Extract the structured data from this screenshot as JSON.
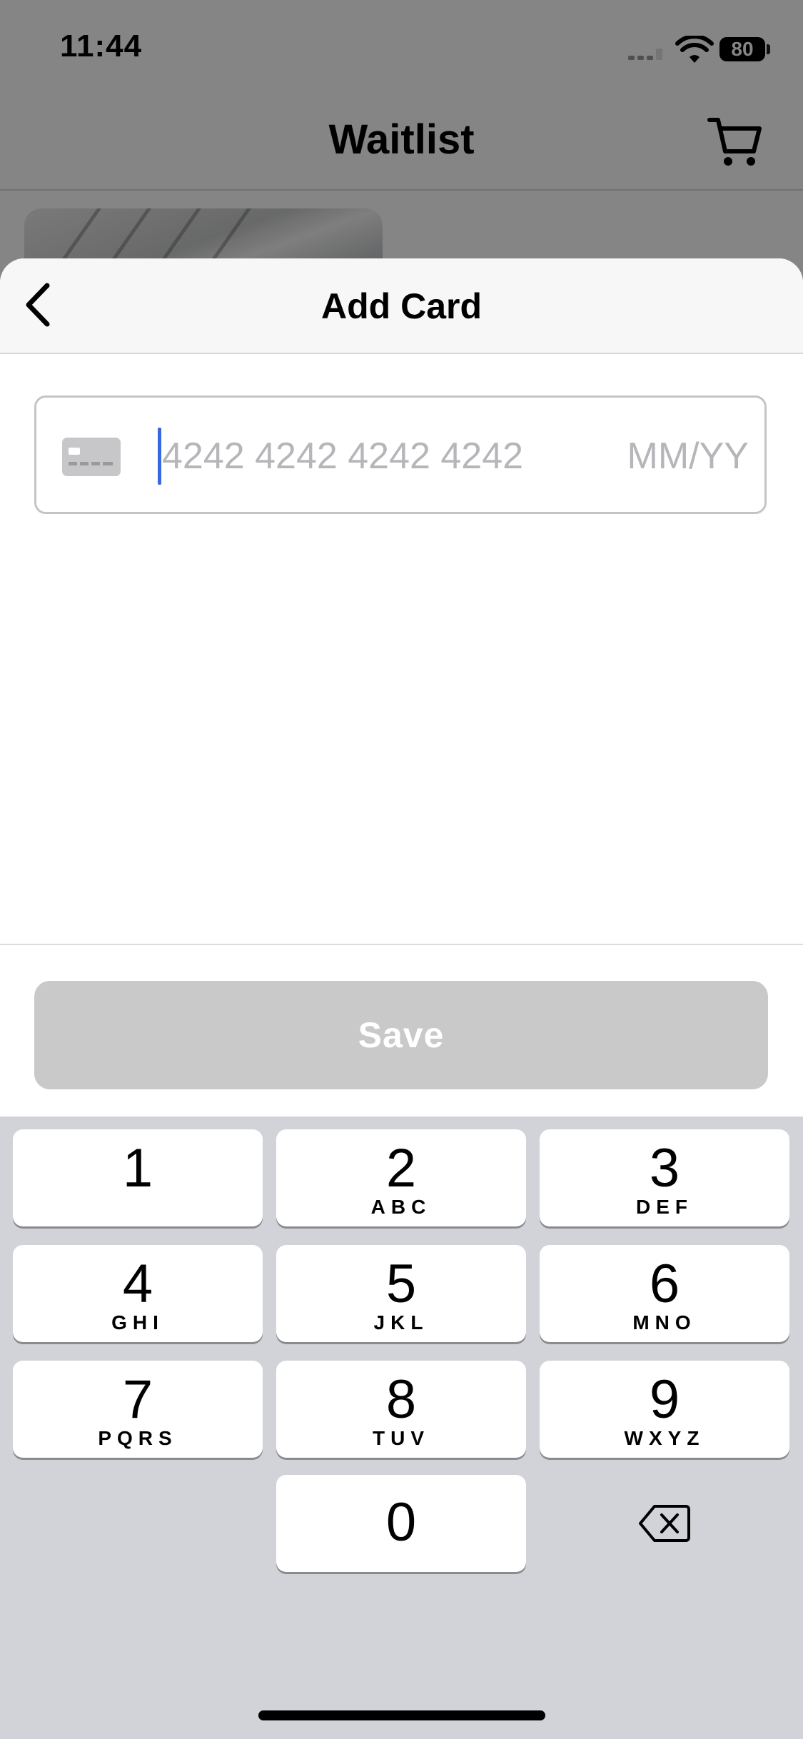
{
  "status_bar": {
    "time": "11:44",
    "battery": "80"
  },
  "background_nav": {
    "title": "Waitlist"
  },
  "sheet": {
    "title": "Add Card",
    "card_number_placeholder": "4242 4242 4242 4242",
    "expiry_placeholder": "MM/YY",
    "save_label": "Save"
  },
  "keyboard": {
    "keys": [
      {
        "num": "1",
        "letters": ""
      },
      {
        "num": "2",
        "letters": "ABC"
      },
      {
        "num": "3",
        "letters": "DEF"
      },
      {
        "num": "4",
        "letters": "GHI"
      },
      {
        "num": "5",
        "letters": "JKL"
      },
      {
        "num": "6",
        "letters": "MNO"
      },
      {
        "num": "7",
        "letters": "PQRS"
      },
      {
        "num": "8",
        "letters": "TUV"
      },
      {
        "num": "9",
        "letters": "WXYZ"
      },
      {
        "num": "0",
        "letters": ""
      }
    ]
  },
  "colors": {
    "caret": "#3a66e0",
    "save_disabled": "#c9c9c9",
    "keyboard_bg": "#d1d3d9"
  }
}
